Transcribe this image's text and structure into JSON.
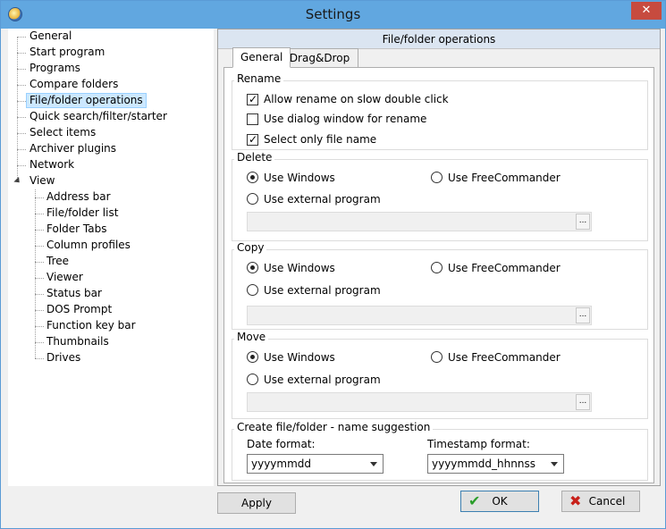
{
  "window": {
    "title": "Settings",
    "close_label": "✕"
  },
  "tree": {
    "items": [
      {
        "label": "General"
      },
      {
        "label": "Start program"
      },
      {
        "label": "Programs"
      },
      {
        "label": "Compare folders"
      },
      {
        "label": "File/folder operations",
        "selected": true
      },
      {
        "label": "Quick search/filter/starter"
      },
      {
        "label": "Select items"
      },
      {
        "label": "Archiver plugins"
      },
      {
        "label": "Network"
      },
      {
        "label": "View",
        "expanded": true
      },
      {
        "label": "Address bar"
      },
      {
        "label": "File/folder list"
      },
      {
        "label": "Folder Tabs"
      },
      {
        "label": "Column profiles"
      },
      {
        "label": "Tree"
      },
      {
        "label": "Viewer"
      },
      {
        "label": "Status bar"
      },
      {
        "label": "DOS Prompt"
      },
      {
        "label": "Function key bar"
      },
      {
        "label": "Thumbnails"
      },
      {
        "label": "Drives"
      }
    ]
  },
  "panel": {
    "header": "File/folder operations",
    "tabs": [
      {
        "label": "General",
        "active": true
      },
      {
        "label": "Drag&Drop"
      }
    ],
    "rename": {
      "title": "Rename",
      "options": [
        {
          "label": "Allow rename on slow double click",
          "checked": true
        },
        {
          "label": "Use dialog window for rename",
          "checked": false
        },
        {
          "label": "Select only file name",
          "checked": true
        }
      ]
    },
    "delete": {
      "title": "Delete",
      "use_windows": "Use Windows",
      "use_freecommander": "Use FreeCommander",
      "use_external": "Use external program",
      "browse": "..."
    },
    "copy": {
      "title": "Copy",
      "use_windows": "Use Windows",
      "use_freecommander": "Use FreeCommander",
      "use_external": "Use external program",
      "browse": "..."
    },
    "move": {
      "title": "Move",
      "use_windows": "Use Windows",
      "use_freecommander": "Use FreeCommander",
      "use_external": "Use external program",
      "browse": "..."
    },
    "name_suggestion": {
      "title": "Create file/folder - name suggestion",
      "date_label": "Date format:",
      "date_value": "yyyymmdd",
      "timestamp_label": "Timestamp format:",
      "timestamp_value": "yyyymmdd_hhnnss"
    }
  },
  "buttons": {
    "apply": "Apply",
    "ok": "OK",
    "cancel": "Cancel"
  }
}
